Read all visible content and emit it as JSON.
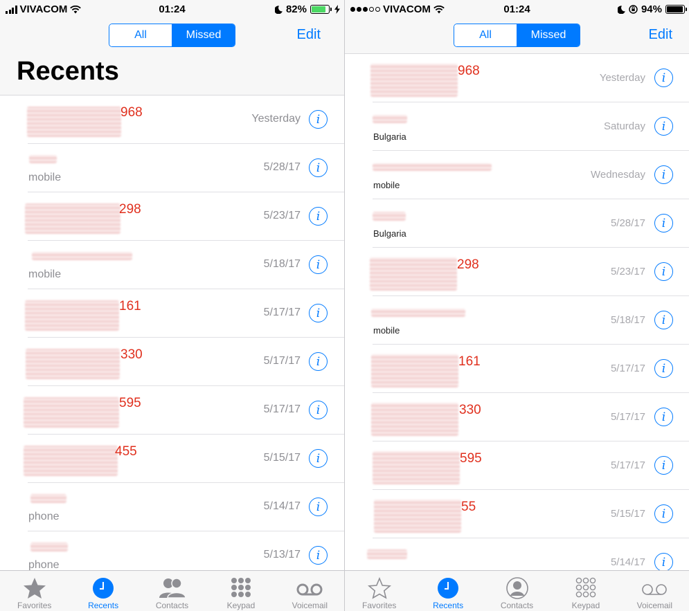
{
  "left": {
    "status": {
      "carrier": "VIVACOM",
      "time": "01:24",
      "battery": "82%",
      "battery_level": 0.82
    },
    "segments": {
      "all": "All",
      "missed": "Missed"
    },
    "edit": "Edit",
    "title": "Recents",
    "rows": [
      {
        "name": "968",
        "sub": "",
        "date": "Yesterday"
      },
      {
        "name": "",
        "sub": "mobile",
        "date": "5/28/17"
      },
      {
        "name": "298",
        "sub": "",
        "date": "5/23/17"
      },
      {
        "name": "",
        "sub": "mobile",
        "date": "5/18/17"
      },
      {
        "name": "161",
        "sub": "",
        "date": "5/17/17"
      },
      {
        "name": "330",
        "sub": "",
        "date": "5/17/17"
      },
      {
        "name": "595",
        "sub": "",
        "date": "5/17/17"
      },
      {
        "name": "455",
        "sub": "",
        "date": "5/15/17"
      },
      {
        "name": "",
        "sub": "phone",
        "date": "5/14/17"
      },
      {
        "name": "",
        "sub": "phone",
        "date": "5/13/17"
      }
    ],
    "tabs": [
      "Favorites",
      "Recents",
      "Contacts",
      "Keypad",
      "Voicemail"
    ]
  },
  "right": {
    "status": {
      "carrier": "VIVACOM",
      "time": "01:24",
      "battery": "94%",
      "battery_level": 0.94
    },
    "segments": {
      "all": "All",
      "missed": "Missed"
    },
    "edit": "Edit",
    "rows": [
      {
        "name": "968",
        "sub": "",
        "date": "Yesterday"
      },
      {
        "name": "",
        "sub": "Bulgaria",
        "date": "Saturday"
      },
      {
        "name": "",
        "sub": "mobile",
        "date": "Wednesday"
      },
      {
        "name": "",
        "sub": "Bulgaria",
        "date": "5/28/17"
      },
      {
        "name": "298",
        "sub": "",
        "date": "5/23/17"
      },
      {
        "name": "",
        "sub": "mobile",
        "date": "5/18/17"
      },
      {
        "name": "161",
        "sub": "",
        "date": "5/17/17"
      },
      {
        "name": "330",
        "sub": "",
        "date": "5/17/17"
      },
      {
        "name": "595",
        "sub": "",
        "date": "5/17/17"
      },
      {
        "name": "55",
        "sub": "",
        "date": "5/15/17"
      },
      {
        "name": "",
        "sub": "",
        "date": "5/14/17"
      }
    ],
    "tabs": [
      "Favorites",
      "Recents",
      "Contacts",
      "Keypad",
      "Voicemail"
    ]
  },
  "colors": {
    "accent": "#007aff",
    "missed": "#e0301e",
    "battery_left": "#4cd964",
    "battery_right": "#000000"
  }
}
